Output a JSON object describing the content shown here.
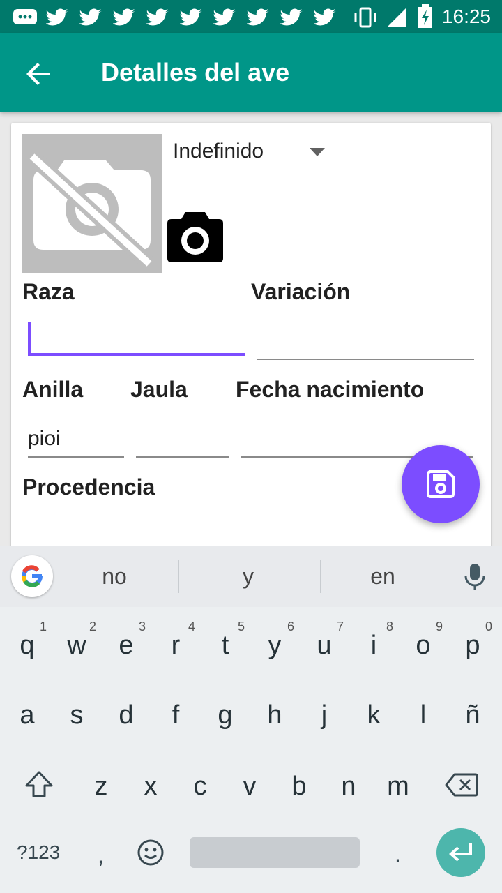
{
  "status_bar": {
    "time": "16:25",
    "icons": [
      "message-icon",
      "twitter-icon",
      "twitter-icon",
      "twitter-icon",
      "twitter-icon",
      "twitter-icon",
      "twitter-icon",
      "twitter-icon",
      "twitter-icon",
      "twitter-icon",
      "vibrate-icon",
      "signal-icon",
      "battery-icon"
    ]
  },
  "app_bar": {
    "title": "Detalles del ave",
    "back_icon": "arrow-back-icon",
    "background": "#009688"
  },
  "form": {
    "sex_spinner": {
      "value": "Indefinido"
    },
    "photo": {
      "icon": "no-photo-icon"
    },
    "camera_button": {
      "icon": "camera-icon"
    },
    "raza": {
      "label": "Raza",
      "value": ""
    },
    "variacion": {
      "label": "Variación",
      "value": ""
    },
    "anilla": {
      "label": "Anilla",
      "value": "pioi"
    },
    "jaula": {
      "label": "Jaula",
      "value": ""
    },
    "fecha": {
      "label": "Fecha nacimiento",
      "value": ""
    },
    "procedencia": {
      "label": "Procedencia"
    },
    "accent": "#7c4dff"
  },
  "fab": {
    "icon": "save-icon",
    "color": "#7c4dff"
  },
  "keyboard": {
    "suggestions": [
      "no",
      "y",
      "en"
    ],
    "row1": [
      "q",
      "w",
      "e",
      "r",
      "t",
      "y",
      "u",
      "i",
      "o",
      "p"
    ],
    "row1_hints": [
      "1",
      "2",
      "3",
      "4",
      "5",
      "6",
      "7",
      "8",
      "9",
      "0"
    ],
    "row2": [
      "a",
      "s",
      "d",
      "f",
      "g",
      "h",
      "j",
      "k",
      "l",
      "ñ"
    ],
    "row3": [
      "z",
      "x",
      "c",
      "v",
      "b",
      "n",
      "m"
    ],
    "symbols_key": "?123",
    "comma_key": ",",
    "period_key": ".",
    "enter_color": "#4db6ac"
  }
}
